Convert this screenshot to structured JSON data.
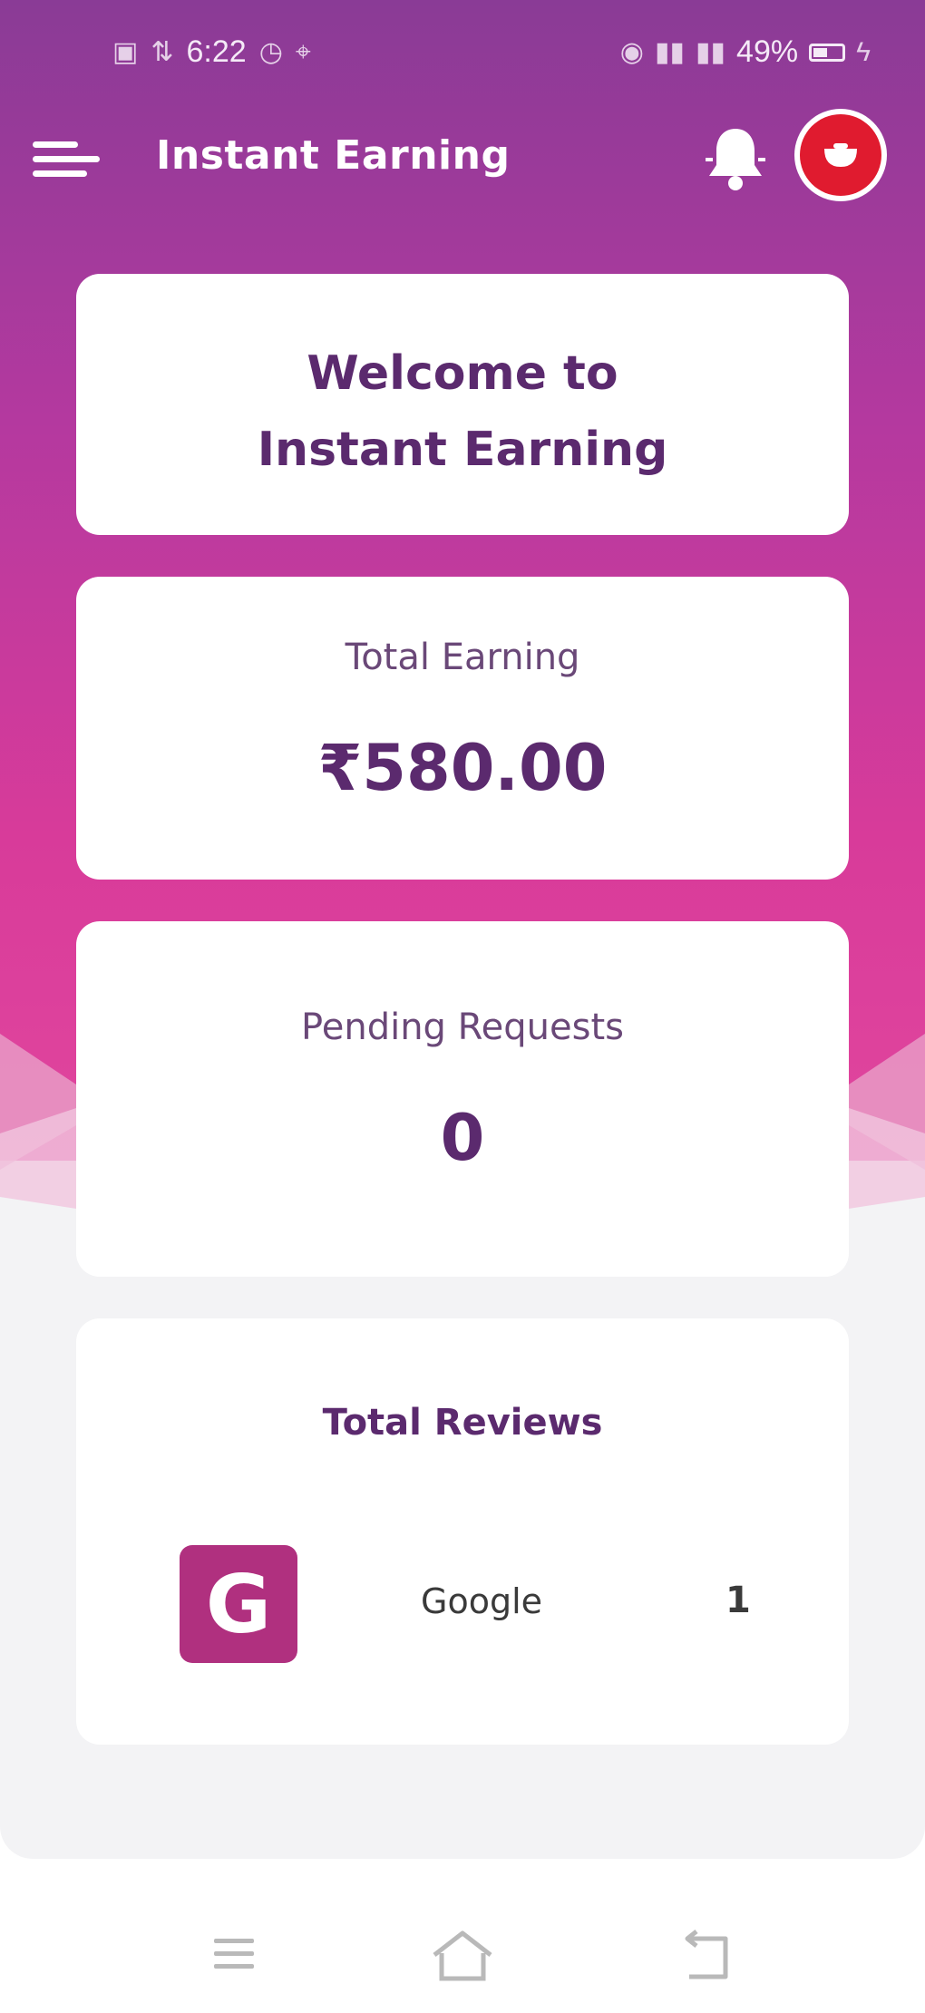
{
  "status_bar": {
    "time": "6:22",
    "battery": "49%"
  },
  "app_bar": {
    "title": "Instant Earning"
  },
  "welcome": {
    "line1": "Welcome to",
    "line2": "Instant Earning"
  },
  "earning": {
    "label": "Total Earning",
    "value": "₹580.00"
  },
  "pending": {
    "label": "Pending Requests",
    "value": "0"
  },
  "reviews": {
    "label": "Total Reviews",
    "items": [
      {
        "icon_letter": "G",
        "name": "Google",
        "count": "1"
      }
    ]
  },
  "colors": {
    "brand_purple": "#8a3b96",
    "brand_pink": "#d83b9a",
    "text_purple": "#5b2a6e",
    "google_icon_bg": "#b0307f",
    "avatar_red": "#e01b2f"
  },
  "icons": {
    "menu": "menu-icon",
    "bell": "bell-icon",
    "avatar": "avatar-icon",
    "nav_recents": "recents-icon",
    "nav_home": "home-icon",
    "nav_back": "back-icon"
  }
}
